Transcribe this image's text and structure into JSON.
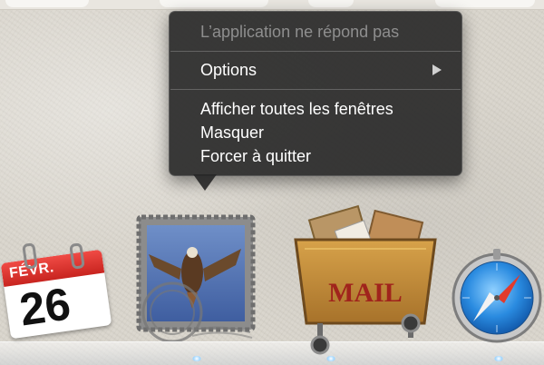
{
  "context_menu": {
    "status": "L’application ne répond pas",
    "options": "Options",
    "show_all_windows": "Afficher toutes les fenêtres",
    "hide": "Masquer",
    "force_quit": "Forcer à quitter"
  },
  "dock": {
    "items": [
      {
        "name": "calendar",
        "month": "FÉVR.",
        "day": "26"
      },
      {
        "name": "mail-stamp",
        "icon": "mail-stamp-icon"
      },
      {
        "name": "mail-cart",
        "label": "MAIL"
      },
      {
        "name": "safari",
        "icon": "compass-icon"
      }
    ]
  },
  "colors": {
    "menu_bg": "#262626",
    "menu_text": "#ffffff",
    "menu_disabled": "#8e8e8e",
    "calendar_red": "#d8332e",
    "mail_label": "#a0241c",
    "safari_blue": "#1f7fd6"
  }
}
